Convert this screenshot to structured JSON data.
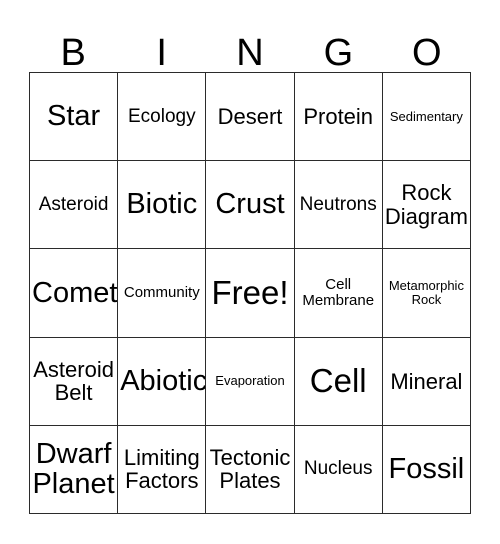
{
  "card": {
    "title_letters": [
      "B",
      "I",
      "N",
      "G",
      "O"
    ],
    "grid_size": "5x5",
    "free_space": "Free!",
    "border_color": "#2b2b2b",
    "background_color": "#ffffff",
    "text_color": "#000000",
    "cells": [
      {
        "text": "Star",
        "size": "lg"
      },
      {
        "text": "Ecology",
        "size": "sm"
      },
      {
        "text": "Desert",
        "size": "md"
      },
      {
        "text": "Protein",
        "size": "md"
      },
      {
        "text": "Sedimentary",
        "size": "xxs"
      },
      {
        "text": "Asteroid",
        "size": "sm"
      },
      {
        "text": "Biotic",
        "size": "lg"
      },
      {
        "text": "Crust",
        "size": "lg"
      },
      {
        "text": "Neutrons",
        "size": "sm"
      },
      {
        "text": "Rock\nDiagram",
        "size": "md"
      },
      {
        "text": "Comet",
        "size": "lg"
      },
      {
        "text": "Community",
        "size": "xs"
      },
      {
        "text": "Free!",
        "size": "xl"
      },
      {
        "text": "Cell\nMembrane",
        "size": "xs"
      },
      {
        "text": "Metamorphic\nRock",
        "size": "xxs"
      },
      {
        "text": "Asteroid\nBelt",
        "size": "md"
      },
      {
        "text": "Abiotic",
        "size": "lg"
      },
      {
        "text": "Evaporation",
        "size": "xxs"
      },
      {
        "text": "Cell",
        "size": "xl"
      },
      {
        "text": "Mineral",
        "size": "md"
      },
      {
        "text": "Dwarf\nPlanet",
        "size": "lg"
      },
      {
        "text": "Limiting\nFactors",
        "size": "md"
      },
      {
        "text": "Tectonic\nPlates",
        "size": "md"
      },
      {
        "text": "Nucleus",
        "size": "sm"
      },
      {
        "text": "Fossil",
        "size": "lg"
      }
    ]
  }
}
